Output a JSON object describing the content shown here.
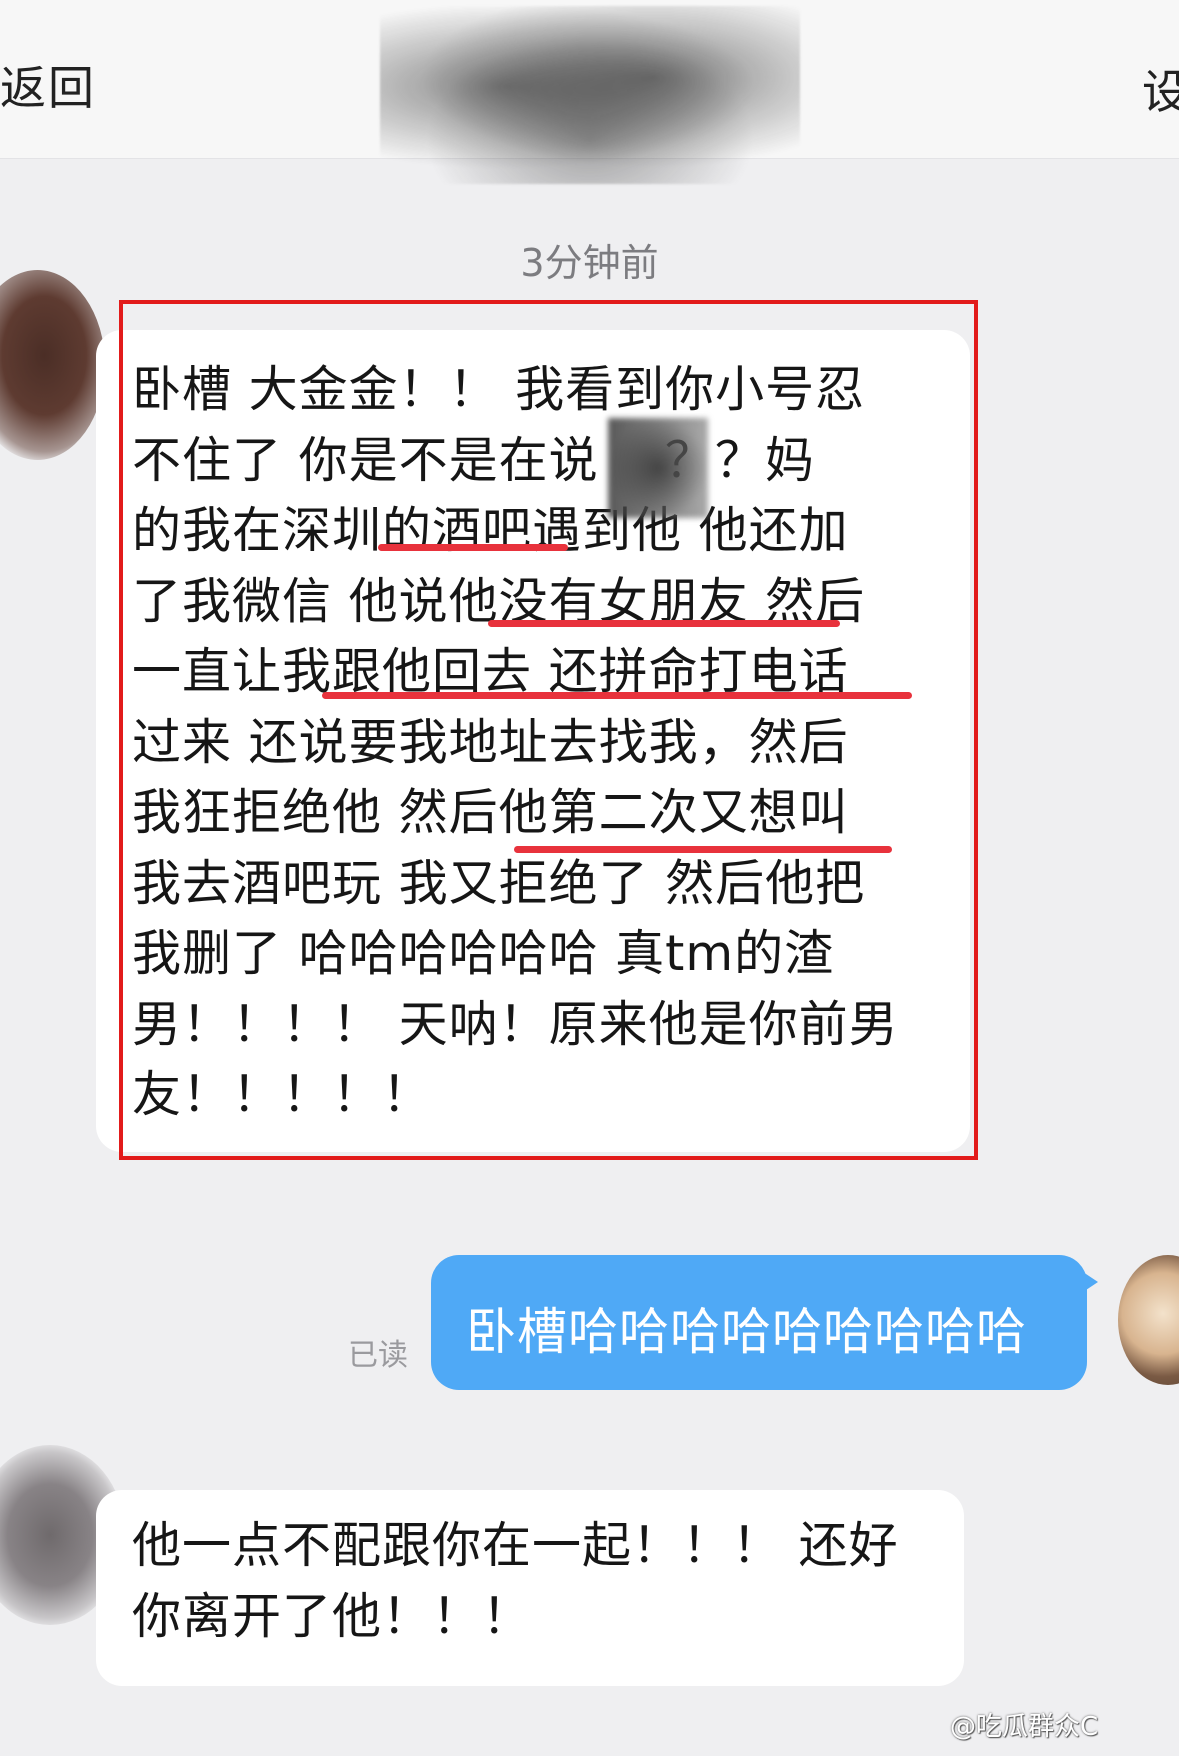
{
  "header": {
    "back_label": "返回",
    "settings_label": "设"
  },
  "chat": {
    "timestamp": "3分钟前",
    "messages": [
      {
        "side": "left",
        "text": "卧槽 大金金！！ 我看到你小号忍\n不住了 你是不是在说    ？？妈\n的我在深圳的酒吧遇到他 他还加\n了我微信 他说他没有女朋友 然后\n一直让我跟他回去 还拼命打电话\n过来 还说要我地址去找我，然后\n我狂拒绝他 然后他第二次又想叫\n我去酒吧玩 我又拒绝了 然后他把\n我删了 哈哈哈哈哈哈 真tm的渣\n男！！！！ 天呐！原来他是你前男\n友！！！！！",
        "highlight_color": "#e21b1b"
      },
      {
        "side": "right",
        "text": "卧槽哈哈哈哈哈哈哈哈哈",
        "status": "已读",
        "bubble_color": "#4fa9f6"
      },
      {
        "side": "left",
        "text": "他一点不配跟你在一起！！！ 还好\n你离开了他！！！"
      }
    ]
  },
  "watermark": "@吃瓜群众C",
  "colors": {
    "background": "#efeff1",
    "underline": "#e8323c"
  }
}
